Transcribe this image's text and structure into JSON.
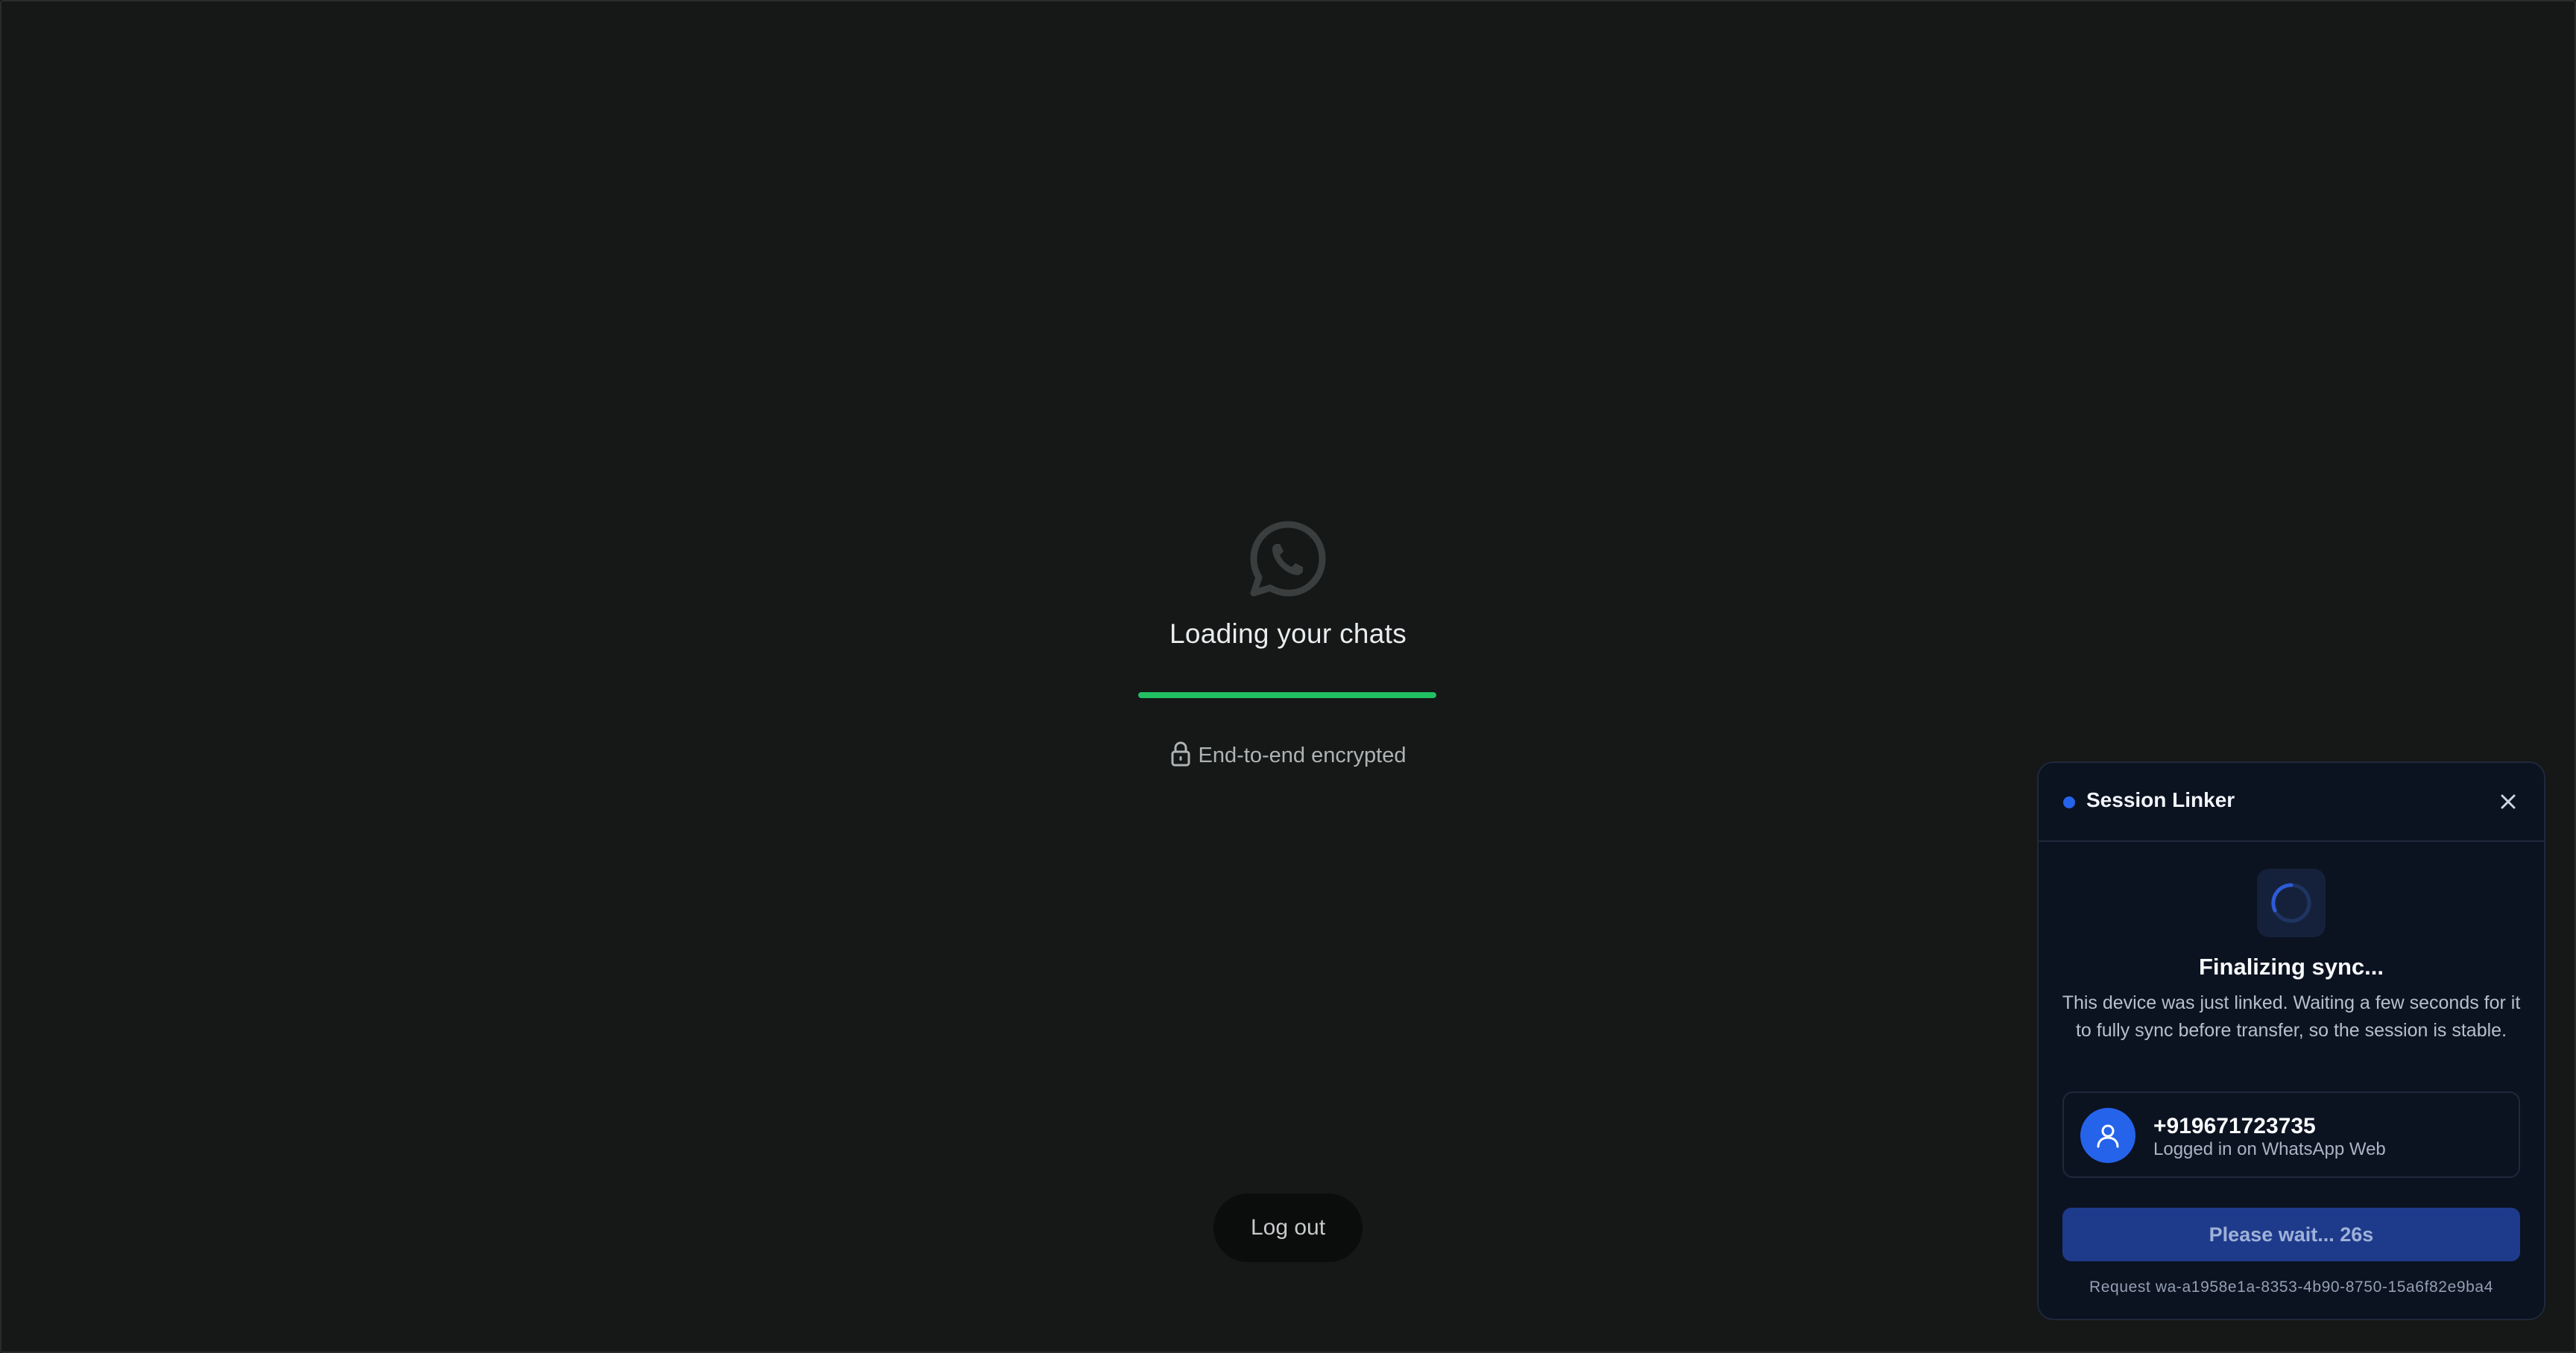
{
  "main": {
    "loading_title": "Loading your chats",
    "progress": 1.0,
    "encrypted_label": "End-to-end encrypted",
    "logout_label": "Log out"
  },
  "panel": {
    "title": "Session Linker",
    "sync_title": "Finalizing sync...",
    "sync_description": "This device was just linked. Waiting a few seconds for it to fully sync before transfer, so the session is stable.",
    "account": {
      "phone": "+919671723735",
      "status": "Logged in on WhatsApp Web"
    },
    "wait_button_label": "Please wait... 26s",
    "request_id": "Request wa-a1958e1a-8353-4b90-8750-15a6f82e9ba4"
  },
  "colors": {
    "background": "#161717",
    "progress": "#21c063",
    "accent_blue": "#2563eb",
    "panel_bg": "#0b1220"
  },
  "icons": {
    "logo": "whatsapp-logo-icon",
    "lock": "lock-icon",
    "close": "close-icon",
    "spinner": "spinner-icon",
    "user": "user-icon"
  }
}
